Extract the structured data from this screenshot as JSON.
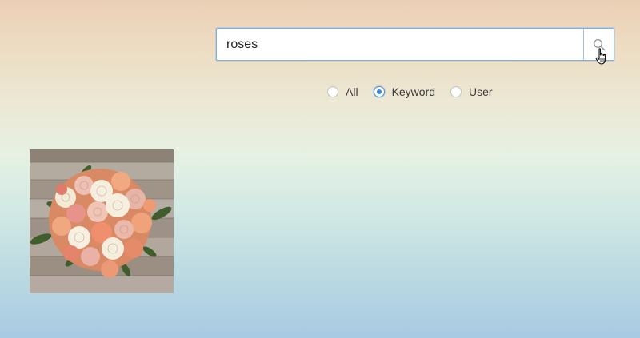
{
  "search": {
    "value": "roses",
    "icon": "magnifier-icon"
  },
  "filter": {
    "options": [
      {
        "label": "All",
        "selected": false
      },
      {
        "label": "Keyword",
        "selected": true
      },
      {
        "label": "User",
        "selected": false
      }
    ]
  },
  "result": {
    "image": "rose-bouquet-image"
  },
  "colors": {
    "focus_border": "#7fb0df",
    "radio_selected": "#3b84d6"
  }
}
